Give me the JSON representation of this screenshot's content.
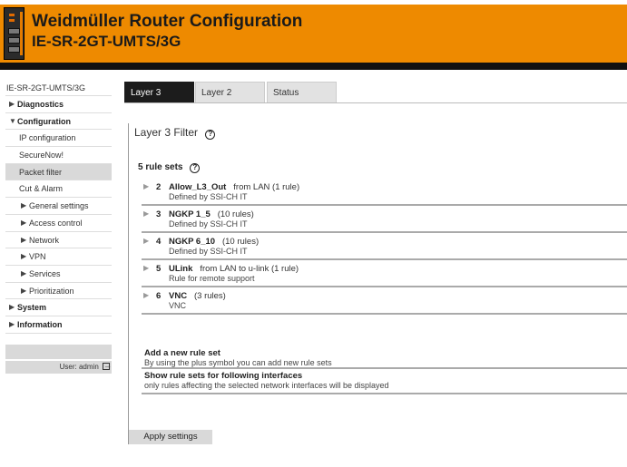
{
  "header": {
    "title": "Weidmüller Router Configuration",
    "model": "IE-SR-2GT-UMTS/3G"
  },
  "sidebar": {
    "device": "IE-SR-2GT-UMTS/3G",
    "items": [
      {
        "label": "Diagnostics"
      },
      {
        "label": "Configuration"
      },
      {
        "label": "IP configuration"
      },
      {
        "label": "SecureNow!"
      },
      {
        "label": "Packet filter"
      },
      {
        "label": "Cut & Alarm"
      },
      {
        "label": "General settings"
      },
      {
        "label": "Access control"
      },
      {
        "label": "Network"
      },
      {
        "label": "VPN"
      },
      {
        "label": "Services"
      },
      {
        "label": "Prioritization"
      },
      {
        "label": "System"
      },
      {
        "label": "Information"
      }
    ],
    "user": "User: admin"
  },
  "tabs": [
    {
      "label": "Layer 3"
    },
    {
      "label": "Layer 2"
    },
    {
      "label": "Status"
    }
  ],
  "main": {
    "title": "Layer 3 Filter",
    "rule_count": "5 rule sets",
    "help_glyph": "?",
    "rules": [
      {
        "num": "2",
        "name": "Allow_L3_Out",
        "info": "from LAN (1 rule)",
        "desc": "Defined by SSI-CH IT"
      },
      {
        "num": "3",
        "name": "NGKP 1_5",
        "info": "(10 rules)",
        "desc": "Defined by SSI-CH IT"
      },
      {
        "num": "4",
        "name": "NGKP 6_10",
        "info": "(10 rules)",
        "desc": "Defined by SSI-CH IT"
      },
      {
        "num": "5",
        "name": "ULink",
        "info": "from LAN to u-link (1 rule)",
        "desc": "Rule for remote support"
      },
      {
        "num": "6",
        "name": "VNC",
        "info": "(3 rules)",
        "desc": "VNC"
      }
    ],
    "add_title": "Add a new rule set",
    "add_desc": "By using the plus symbol you can add new rule sets",
    "iface_title": "Show rule sets for following interfaces",
    "iface_desc": "only rules affecting the selected network interfaces will be displayed",
    "apply_label": "Apply settings"
  },
  "colors": {
    "header_orange": "#ee8a00",
    "tab_active": "#1c1c1c"
  },
  "icons": {
    "expand": "triangle-right-icon",
    "help": "help-icon",
    "logout": "logout-icon"
  }
}
